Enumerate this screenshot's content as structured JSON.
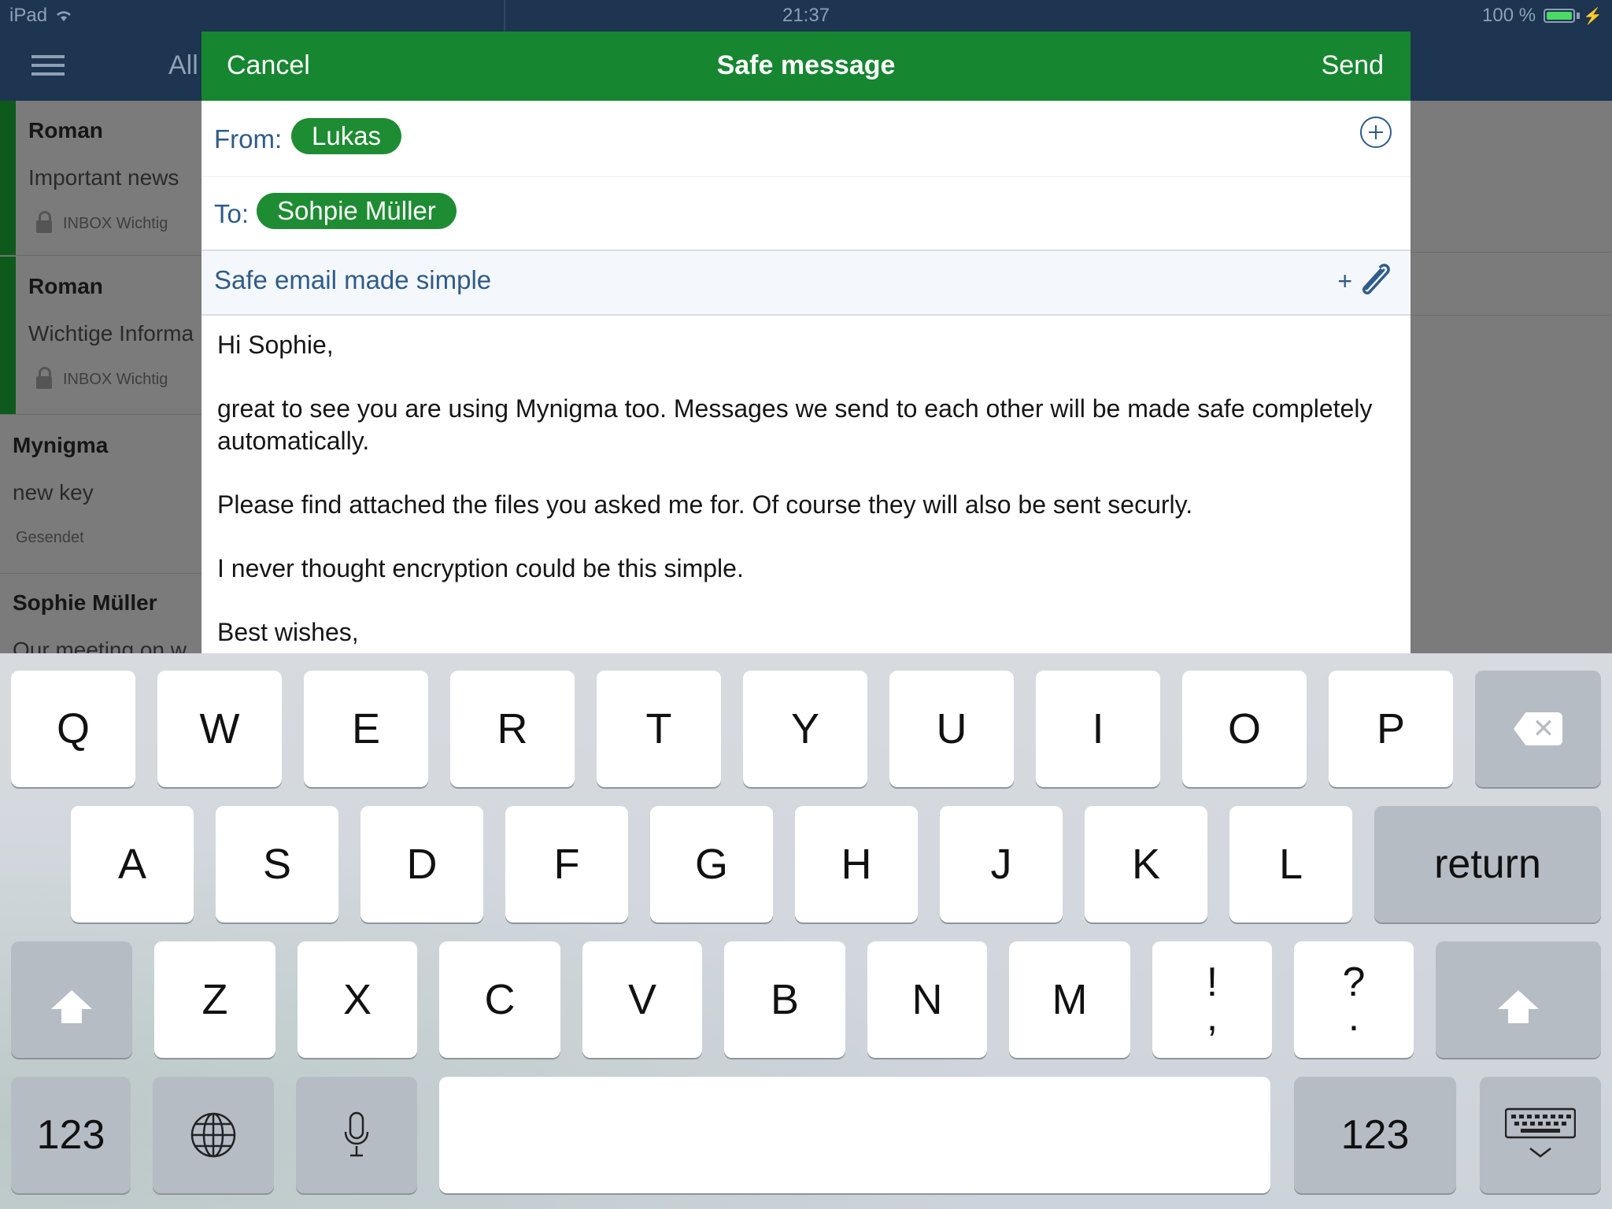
{
  "status_bar": {
    "device": "iPad",
    "time": "21:37",
    "battery": "100 %"
  },
  "nav": {
    "filter_label": "All"
  },
  "sidebar": {
    "messages": [
      {
        "sender": "Roman",
        "subject": "Important news",
        "folder": "INBOX Wichtig",
        "locked": true
      },
      {
        "sender": "Roman",
        "subject": "Wichtige Informa",
        "folder": "INBOX Wichtig",
        "locked": true
      },
      {
        "sender": "Mynigma",
        "subject": "new key",
        "folder": "Gesendet",
        "locked": false
      },
      {
        "sender": "Sophie Müller",
        "subject": "Our meeting on w",
        "folder": "",
        "locked": false
      }
    ]
  },
  "composer": {
    "cancel_label": "Cancel",
    "title": "Safe message",
    "send_label": "Send",
    "from_label": "From:",
    "from_value": "Lukas",
    "to_label": "To:",
    "to_value": "Sohpie Müller",
    "subject": "Safe email made simple",
    "attach_plus": "+",
    "body": {
      "greeting": "Hi Sophie,",
      "para1": "great to see you are using Mynigma too. Messages we send to each other will be made safe completely automatically.",
      "para2": "Please find attached the files you asked me for. Of course they will also be sent securly.",
      "para3": "I never thought encryption could be this simple.",
      "closing": "Best wishes,"
    }
  },
  "keyboard": {
    "row1": [
      "Q",
      "W",
      "E",
      "R",
      "T",
      "Y",
      "U",
      "I",
      "O",
      "P"
    ],
    "row2": [
      "A",
      "S",
      "D",
      "F",
      "G",
      "H",
      "J",
      "K",
      "L"
    ],
    "row3": [
      "Z",
      "X",
      "C",
      "V",
      "B",
      "N",
      "M"
    ],
    "return_label": "return",
    "exclaim_top": "!",
    "exclaim_bottom": ",",
    "question_top": "?",
    "question_bottom": ".",
    "numbers_label": "123",
    "icons": [
      "delete-icon",
      "shift-icon",
      "globe-icon",
      "microphone-icon",
      "keyboard-dismiss-icon"
    ]
  },
  "colors": {
    "nav_bg": "#1d3550",
    "header_green": "#168630",
    "chip_green": "#1e8c32",
    "link_blue": "#2f5c88"
  }
}
